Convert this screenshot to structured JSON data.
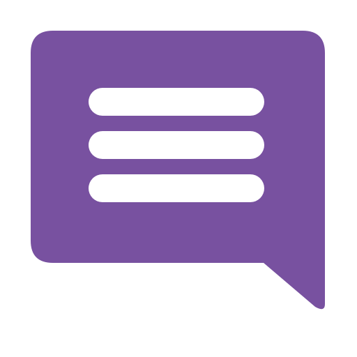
{
  "icon": {
    "name": "chat-bubble-message-icon",
    "colors": {
      "bubble": "#7851A0",
      "lines": "#FFFFFF",
      "background": "#FFFFFF"
    },
    "line_count": 3
  }
}
